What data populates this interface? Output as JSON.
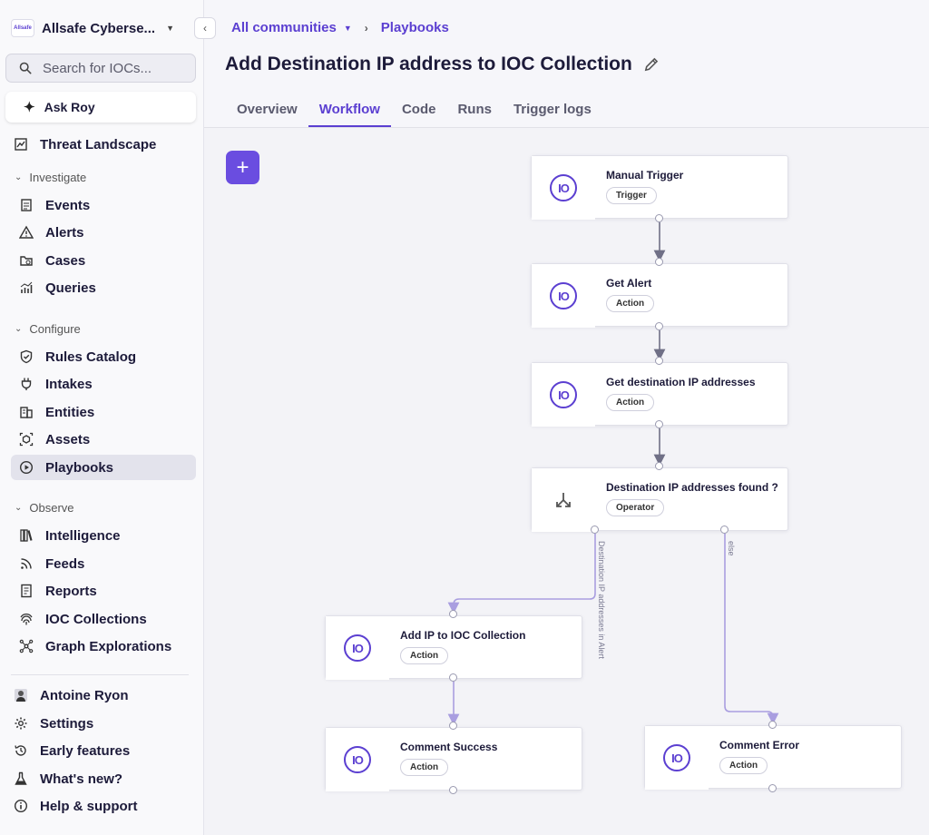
{
  "org": {
    "logo_text": "Allsafe",
    "name": "Allsafe Cyberse..."
  },
  "search": {
    "placeholder": "Search for IOCs..."
  },
  "ask_roy": {
    "label": "Ask Roy"
  },
  "nav": {
    "threat_landscape": "Threat Landscape",
    "investigate": {
      "label": "Investigate",
      "items": [
        "Events",
        "Alerts",
        "Cases",
        "Queries"
      ]
    },
    "configure": {
      "label": "Configure",
      "items": [
        "Rules Catalog",
        "Intakes",
        "Entities",
        "Assets",
        "Playbooks"
      ]
    },
    "observe": {
      "label": "Observe",
      "items": [
        "Intelligence",
        "Feeds",
        "Reports",
        "IOC Collections",
        "Graph Explorations"
      ]
    },
    "bottom": [
      "Antoine Ryon",
      "Settings",
      "Early features",
      "What's new?",
      "Help & support"
    ],
    "active": "Playbooks"
  },
  "breadcrumb": {
    "root": "All communities",
    "current": "Playbooks"
  },
  "page_title": "Add Destination IP address to IOC Collection",
  "tabs": [
    "Overview",
    "Workflow",
    "Code",
    "Runs",
    "Trigger logs"
  ],
  "active_tab": "Workflow",
  "add_button": "+",
  "workflow": {
    "nodes": [
      {
        "title": "Manual Trigger",
        "badge": "Trigger"
      },
      {
        "title": "Get Alert",
        "badge": "Action"
      },
      {
        "title": "Get destination IP addresses",
        "badge": "Action"
      },
      {
        "title": "Destination IP addresses found ?",
        "badge": "Operator"
      },
      {
        "title": "Add IP to IOC Collection",
        "badge": "Action"
      },
      {
        "title": "Comment Success",
        "badge": "Action"
      },
      {
        "title": "Comment Error",
        "badge": "Action"
      }
    ],
    "edge_labels": {
      "true_branch": "Destination IP addresses in Alert",
      "else_branch": "else"
    },
    "icon_text": "IO"
  },
  "colors": {
    "accent": "#5b3fd1",
    "button": "#6a4de0",
    "wire_main": "#6f6f86",
    "wire_branch": "#a99ee0"
  }
}
